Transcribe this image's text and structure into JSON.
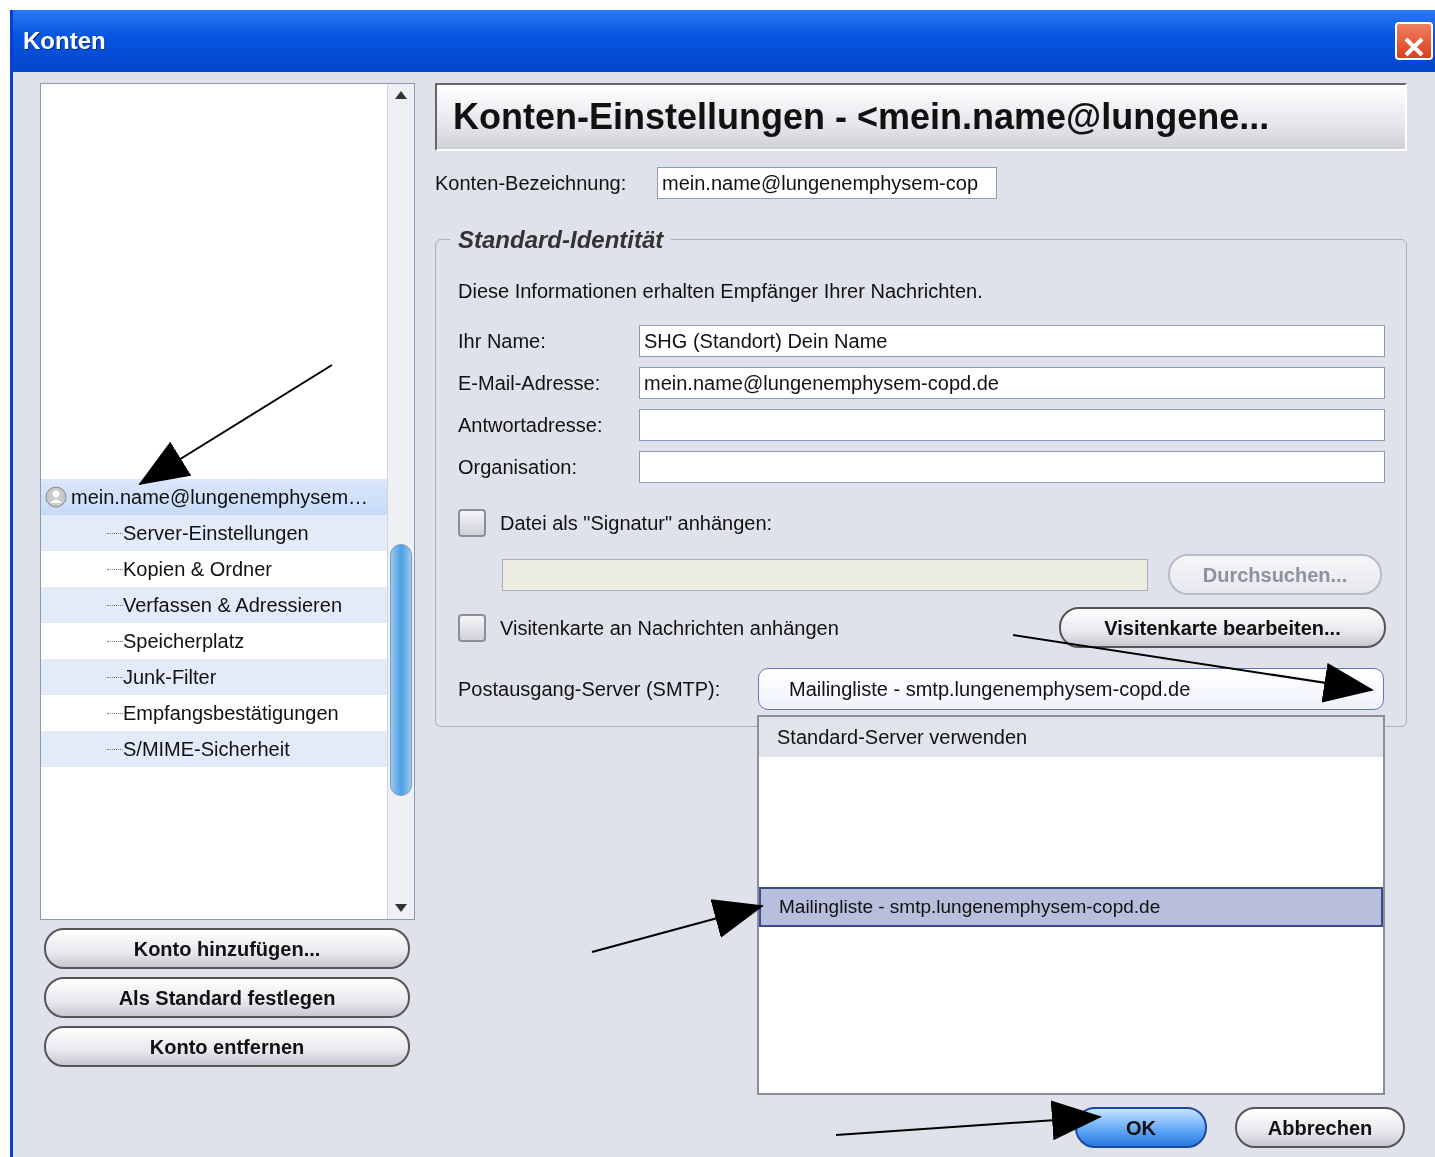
{
  "window": {
    "title": "Konten"
  },
  "account_tree": {
    "items": [
      {
        "label": "mein.name@lungenemphysem…",
        "selected": true,
        "expanded": true,
        "children": [
          {
            "label": "Server-Einstellungen",
            "selected": false
          },
          {
            "label": "Kopien & Ordner",
            "selected": false
          },
          {
            "label": "Verfassen & Adressieren",
            "selected": false
          },
          {
            "label": "Speicherplatz",
            "selected": false
          },
          {
            "label": "Junk-Filter",
            "selected": false
          },
          {
            "label": "Empfangsbestätigungen",
            "selected": false
          },
          {
            "label": "S/MIME-Sicherheit",
            "selected": false
          }
        ]
      }
    ]
  },
  "account_buttons": [
    "Konto hinzufügen...",
    "Als Standard festlegen",
    "Konto entfernen"
  ],
  "settings": {
    "header": "Konten-Einstellungen - <mein.name@lungene...",
    "account_name": {
      "label": "Konten-Bezeichnung:",
      "value": "mein.name@lungenemphysem-cop"
    },
    "identity": {
      "legend": "Standard-Identität",
      "description": "Diese Informationen erhalten Empfänger Ihrer Nachrichten.",
      "fields": [
        {
          "label": "Ihr Name:",
          "value": "SHG (Standort) Dein Name"
        },
        {
          "label": "E-Mail-Adresse:",
          "value": "mein.name@lungenemphysem-copd.de"
        },
        {
          "label": "Antwortadresse:"
        },
        {
          "label": "Organisation:"
        }
      ],
      "signature": {
        "label": "Datei als \"Signatur\" anhängen:",
        "checked": false,
        "browse_button": {
          "label": "Durchsuchen...",
          "disabled": true
        }
      },
      "vcard": {
        "label": "Visitenkarte an Nachrichten anhängen",
        "checked": false,
        "button": "Visitenkarte bearbeiten..."
      },
      "smtp": {
        "label": "Postausgang-Server (SMTP):",
        "value": "Mailingliste - smtp.lungenemphysem-copd.de",
        "expanded": true,
        "options": [
          {
            "label": "Standard-Server verwenden",
            "selected": false
          },
          {
            "label": "Mailingliste - smtp.lungenemphysem-copd.de",
            "selected": true
          }
        ]
      }
    }
  },
  "buttons": [
    {
      "label": "OK",
      "default": true
    },
    {
      "label": "Abbrechen",
      "default": false
    }
  ]
}
